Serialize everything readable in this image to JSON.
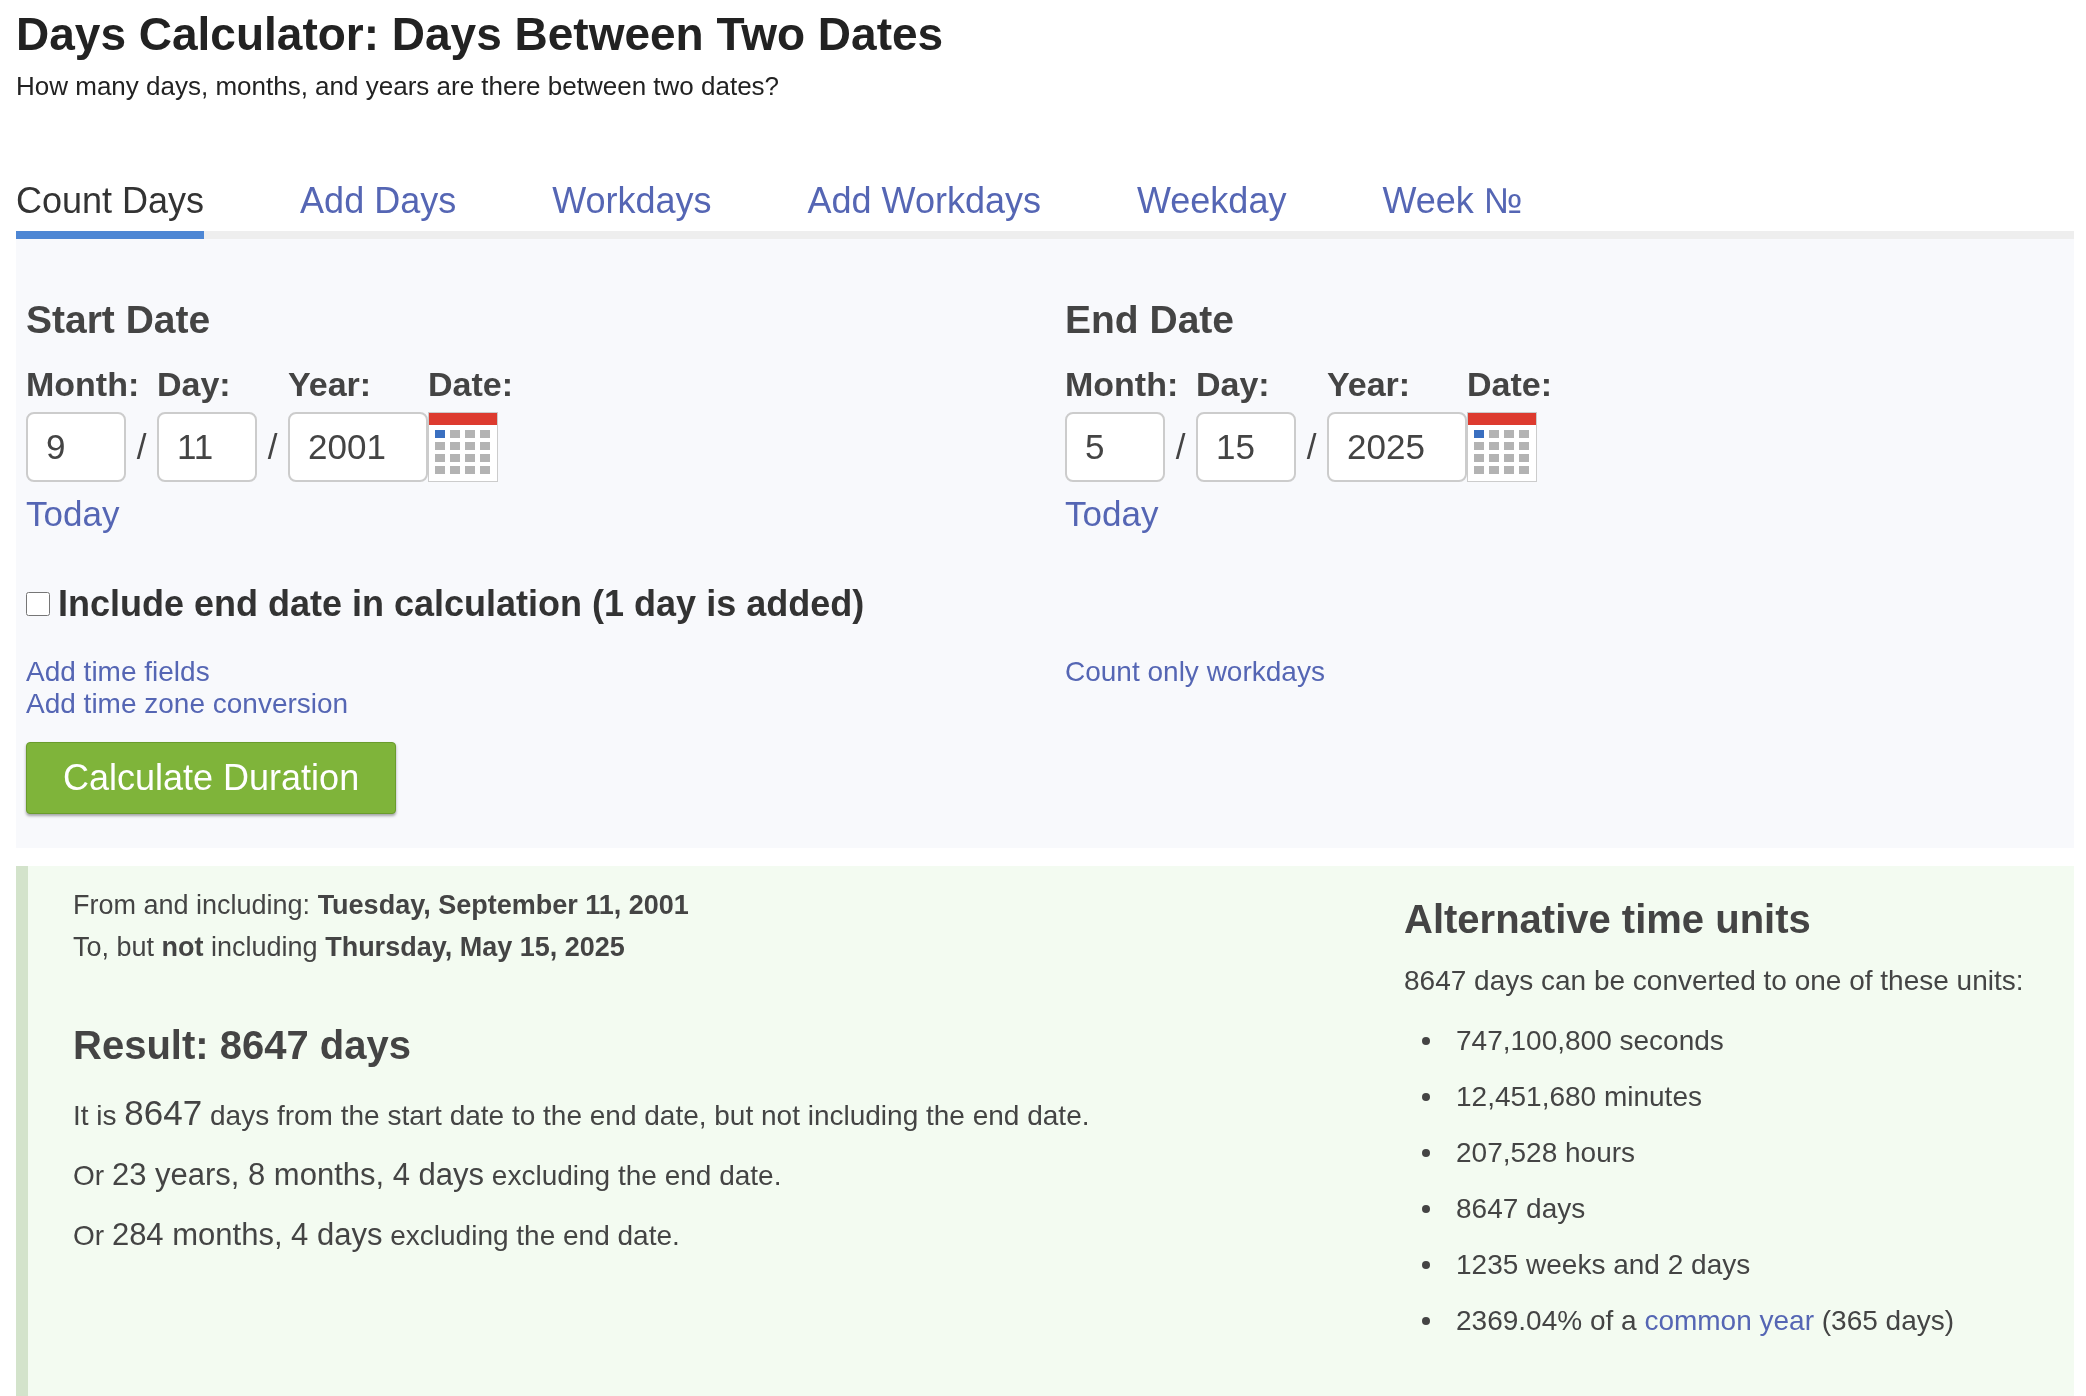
{
  "page": {
    "title": "Days Calculator: Days Between Two Dates",
    "subtitle": "How many days, months, and years are there between two dates?"
  },
  "tabs": [
    {
      "label": "Count Days",
      "selected": true
    },
    {
      "label": "Add Days",
      "selected": false
    },
    {
      "label": "Workdays",
      "selected": false
    },
    {
      "label": "Add Workdays",
      "selected": false
    },
    {
      "label": "Weekday",
      "selected": false
    },
    {
      "label": "Week №",
      "selected": false
    }
  ],
  "dates": [
    {
      "heading": "Start Date",
      "labels": [
        "Month:",
        "Day:",
        "Year:",
        "Date:"
      ],
      "month": "9",
      "day": "11",
      "year": "2001",
      "separator": "/",
      "today_link": "Today",
      "links": [
        "Add time fields",
        "Add time zone conversion"
      ]
    },
    {
      "heading": "End Date",
      "labels": [
        "Month:",
        "Day:",
        "Year:",
        "Date:"
      ],
      "month": "5",
      "day": "15",
      "year": "2025",
      "separator": "/",
      "today_link": "Today",
      "links": [
        "Count only workdays"
      ]
    }
  ],
  "include_end_date": {
    "label": "Include end date in calculation (1 day is added)",
    "checked": false
  },
  "calculate_button": "Calculate Duration",
  "result": {
    "from": "From and including: **Tuesday, September 11, 2001**",
    "to": "To, but **not** including **Thursday, May 15, 2025**",
    "heading": "Result: 8647 days",
    "lines": [
      [
        {
          "text": "It is ",
          "kind": "normal"
        },
        {
          "text": "8647",
          "kind": "large"
        },
        {
          "text": " days from the start date to the end date, but not including the end date.",
          "kind": "normal"
        }
      ],
      [
        {
          "text": "Or ",
          "kind": "normal"
        },
        {
          "text": "23 years, 8 months, 4 days",
          "kind": "medium"
        },
        {
          "text": " excluding the end date.",
          "kind": "normal"
        }
      ],
      [
        {
          "text": "Or ",
          "kind": "normal"
        },
        {
          "text": "284 months, 4 days",
          "kind": "medium"
        },
        {
          "text": " excluding the end date.",
          "kind": "normal"
        }
      ]
    ]
  },
  "alternative_units": {
    "heading": "Alternative time units",
    "intro": "8647 days can be converted to one of these units:",
    "items": [
      {
        "text": "747,100,800 seconds"
      },
      {
        "text": "12,451,680 minutes"
      },
      {
        "text": "207,528 hours"
      },
      {
        "text": "8647 days"
      },
      {
        "text": "1235 weeks and 2 days"
      },
      {
        "text": "2369.04% of a ",
        "link": "common year",
        "after": " (365 days)"
      }
    ]
  }
}
